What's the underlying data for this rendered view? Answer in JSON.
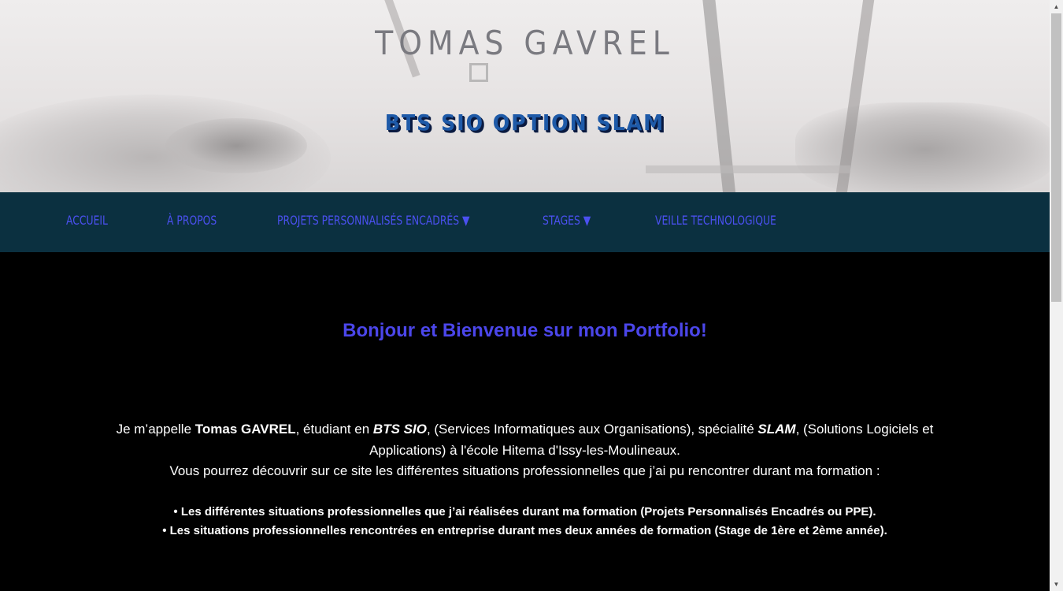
{
  "header": {
    "title": "TOMAS GAVREL",
    "subtitle": "BTS SIO OPTION SLAM"
  },
  "nav": {
    "items": [
      {
        "label": "ACCUEIL"
      },
      {
        "label": "À PROPOS"
      },
      {
        "label": "PROJETS PERSONNALISÉS ENCADRÉS ▼"
      },
      {
        "label": "STAGES ▼"
      },
      {
        "label": "VEILLE TECHNOLOGIQUE"
      }
    ]
  },
  "main": {
    "welcome": "Bonjour et Bienvenue sur mon Portfolio!",
    "intro": {
      "p1_a": "Je m’appelle ",
      "name": "Tomas GAVREL",
      "p1_b": ",  étudiant en ",
      "bts": "BTS SIO",
      "p1_c": ", (Services Informatiques aux Organisations), spécialité ",
      "slam": "SLAM",
      "p1_d": ", (Solutions Logiciels et Applications) à l'école Hitema d'Issy-les-Moulineaux.",
      "p2": "Vous pourrez découvrir sur ce site les différentes situations professionnelles que j’ai pu rencontrer durant ma formation :"
    },
    "list": [
      "• Les différentes situations professionnelles que j’ai réalisées durant ma formation (Projets Personnalisés Encadrés ou PPE).",
      "• Les situations professionnelles rencontrées en entreprise durant mes deux années de formation (Stage de 1ère et 2ème année)."
    ]
  },
  "colors": {
    "nav_bg": "#0b3040",
    "nav_link": "#4b50f0",
    "welcome": "#4b46ea",
    "subtitle": "#1e5aa8"
  },
  "icons": {
    "scroll_up": "▲",
    "scroll_down": "▼"
  }
}
